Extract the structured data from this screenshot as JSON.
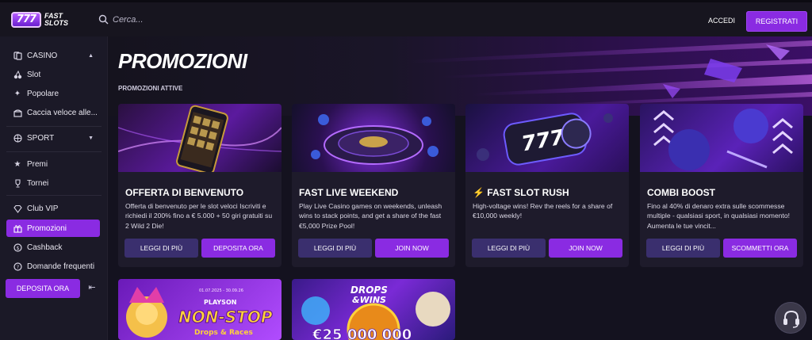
{
  "header": {
    "logo_badge": "777",
    "logo_text_1": "FAST",
    "logo_text_2": "SLOTS",
    "search_placeholder": "Cerca...",
    "login_label": "ACCEDI",
    "register_label": "REGISTRATI"
  },
  "sidebar": {
    "casino_label": "CASINO",
    "slot_label": "Slot",
    "popolare_label": "Popolare",
    "caccia_label": "Caccia veloce alle...",
    "sport_label": "SPORT",
    "premi_label": "Premi",
    "tornei_label": "Tornei",
    "club_vip_label": "Club VIP",
    "promozioni_label": "Promozioni",
    "cashback_label": "Cashback",
    "faq_label": "Domande frequenti",
    "deposit_label": "DEPOSITA ORA"
  },
  "main": {
    "title": "PROMOZIONI",
    "section_label": "PROMOZIONI ATTIVE"
  },
  "cards": [
    {
      "title": "OFFERTA DI BENVENUTO",
      "desc": "Offerta di benvenuto per le slot veloci Iscriviti e richiedi il 200% fino a € 5.000 + 50 giri gratuiti su 2 Wild 2 Die!",
      "secondary": "LEGGI DI PIÙ",
      "primary": "DEPOSITA ORA"
    },
    {
      "title": "FAST LIVE WEEKEND",
      "desc": "Play Live Casino games on weekends, unleash wins to stack points, and get a share of the fast €5,000 Prize Pool!",
      "secondary": "LEGGI DI PIÙ",
      "primary": "JOIN NOW"
    },
    {
      "title": "⚡ FAST SLOT RUSH",
      "desc": "High-voltage wins! Rev the reels for a share of €10,000 weekly!",
      "secondary": "LEGGI DI PIÙ",
      "primary": "JOIN NOW"
    },
    {
      "title": "COMBI BOOST",
      "desc": "Fino al 40% di denaro extra sulle scommesse multiple - qualsiasi sport, in qualsiasi momento! Aumenta le tue vincit...",
      "secondary": "LEGGI DI PIÙ",
      "primary": "SCOMMETTI ORA"
    }
  ],
  "bottom_cards": {
    "card1_date": "01.07.2025 - 30.09.26",
    "card1_brand": "PLAYSON",
    "card1_title": "NON-STOP",
    "card1_subtitle": "Drops & Races",
    "card2_title_1": "DROPS",
    "card2_title_2": "&WINS",
    "card2_amount": "€25 000 000"
  },
  "colors": {
    "accent": "#8a2be2",
    "secondary_button": "#3a2f6e",
    "background": "#14121f"
  }
}
